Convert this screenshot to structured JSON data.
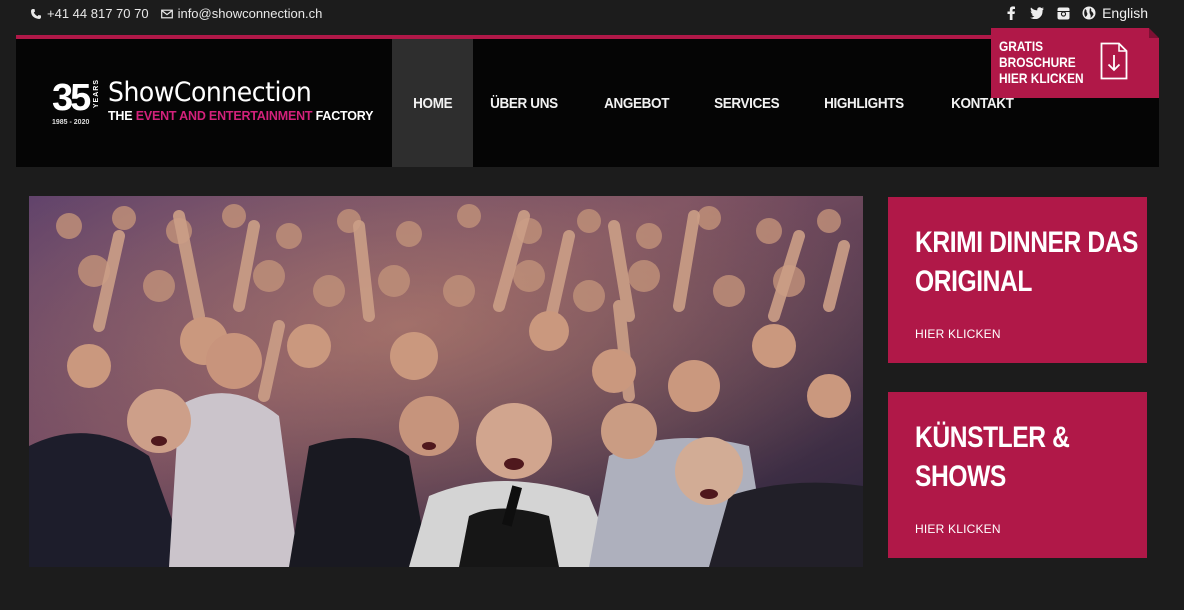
{
  "topbar": {
    "phone": "+41 44 817 70 70",
    "email": "info@showconnection.ch",
    "language": "English",
    "social_icons": [
      "facebook-icon",
      "twitter-icon",
      "instagram-icon",
      "globe-icon"
    ]
  },
  "logo": {
    "number": "35",
    "years": "YEARS",
    "dates": "1985 - 2020",
    "brand": "ShowConnection",
    "tag_pre": "THE ",
    "tag_highlight": "EVENT AND ENTERTAINMENT",
    "tag_post": " FACTORY"
  },
  "nav": {
    "items": [
      {
        "label": "HOME",
        "active": true
      },
      {
        "label": "ÜBER UNS",
        "active": false
      },
      {
        "label": "ANGEBOT",
        "active": false
      },
      {
        "label": "SERVICES",
        "active": false
      },
      {
        "label": "HIGHLIGHTS",
        "active": false
      },
      {
        "label": "KONTAKT",
        "active": false
      }
    ]
  },
  "brochure": {
    "line1": "GRATIS",
    "line2": "BROSCHURE",
    "line3": "HIER KLICKEN"
  },
  "cards": [
    {
      "title_line1": "KRIMI DINNER DAS",
      "title_line2": "ORIGINAL",
      "link": "HIER KLICKEN"
    },
    {
      "title_line1": "KÜNSTLER &",
      "title_line2": "SHOWS",
      "link": "HIER KLICKEN"
    }
  ],
  "colors": {
    "accent": "#b01848",
    "background": "#1c1c1c",
    "header": "#050505",
    "magenta_text": "#d3217b"
  }
}
